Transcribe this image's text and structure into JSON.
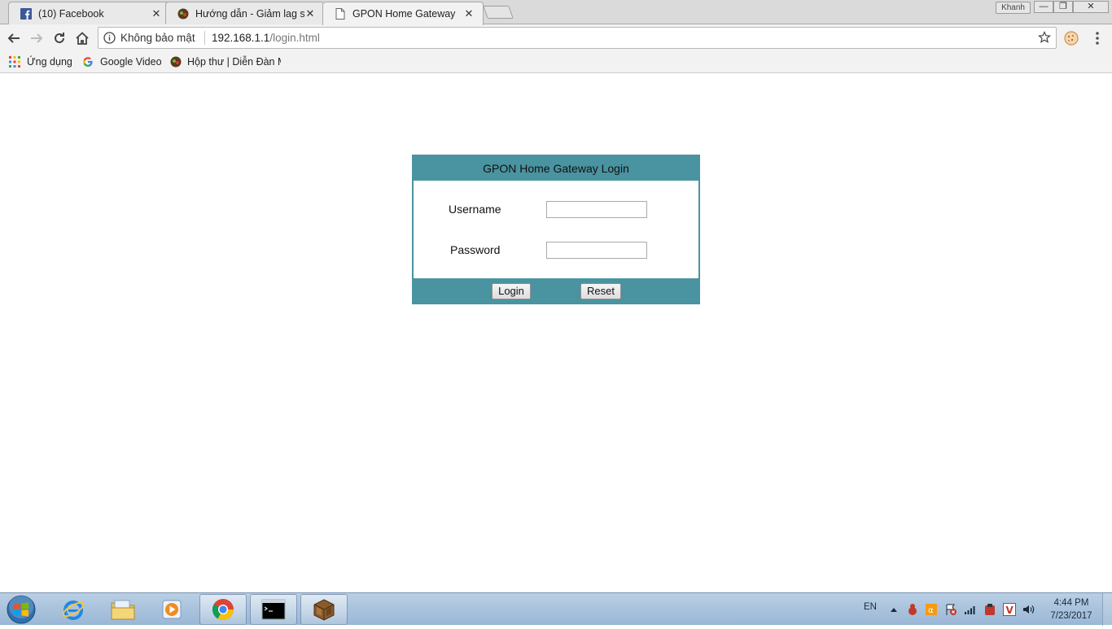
{
  "browser": {
    "tabs": [
      {
        "title": "(10) Facebook",
        "icon": "facebook-icon"
      },
      {
        "title": "Hướng dẫn - Giảm lag se",
        "icon": "forum-icon"
      },
      {
        "title": "GPON Home Gateway",
        "icon": "page-icon"
      }
    ],
    "profile_name": "Khanh",
    "omnibox": {
      "security_text": "Không bảo mật",
      "url_host": "192.168.1.1",
      "url_path": "/login.html"
    },
    "bookmarks": [
      {
        "label": "Ứng dụng",
        "icon": "apps-grid-icon"
      },
      {
        "label": "Google Video",
        "icon": "google-icon"
      },
      {
        "label": "Hộp thư | Diễn Đàn M",
        "icon": "forum-icon"
      }
    ]
  },
  "login": {
    "title": "GPON Home Gateway Login",
    "username_label": "Username",
    "username_value": "",
    "password_label": "Password",
    "password_value": "",
    "login_button": "Login",
    "reset_button": "Reset"
  },
  "taskbar": {
    "language": "EN",
    "time": "4:44 PM",
    "date": "7/23/2017"
  },
  "colors": {
    "login_accent": "#4a93a0"
  }
}
